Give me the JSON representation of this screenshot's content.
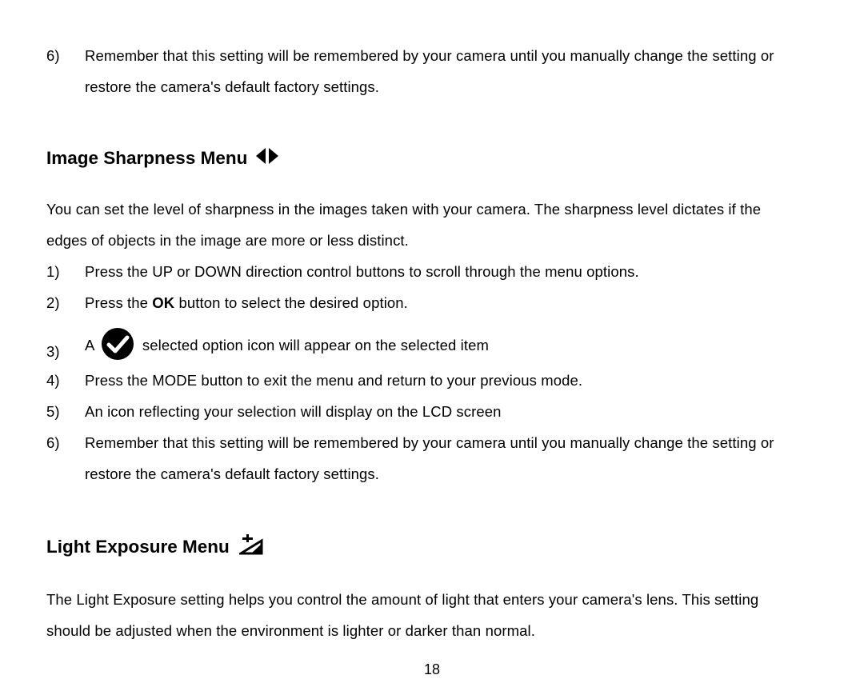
{
  "page_number": "18",
  "top_item": {
    "n": "6)",
    "text_a": "Remember that this setting will be remembered by your camera until you manually change the setting or",
    "text_b": "restore the camera's default factory settings."
  },
  "section_sharpness": {
    "title": "Image Sharpness Menu",
    "intro_a": "You can set the level of sharpness in the images taken with your camera. The sharpness level dictates if the",
    "intro_b": "edges of objects in the image are more or less distinct.",
    "items": {
      "n1": "1)",
      "t1": "Press the UP or DOWN direction control buttons to scroll through the menu options.",
      "n2": "2)",
      "t2a": "Press the ",
      "t2b": "OK",
      "t2c": " button to select the desired option.",
      "n3": "3)",
      "t3a": "A ",
      "t3b": " selected option icon will appear on the selected item",
      "n4": "4)",
      "t4": "Press the MODE button to exit the menu and return to your previous mode.",
      "n5": "5)",
      "t5": "An icon reflecting your selection will display on the LCD screen",
      "n6": "6)",
      "t6a": "Remember that this setting will be remembered by your camera until you manually change the setting or",
      "t6b": "restore the camera's default factory settings."
    }
  },
  "section_exposure": {
    "title": "Light Exposure Menu",
    "intro_a": "The Light Exposure setting helps you control the amount of light that enters your camera's lens. This setting",
    "intro_b": "should be adjusted when the environment is lighter or darker than normal."
  }
}
